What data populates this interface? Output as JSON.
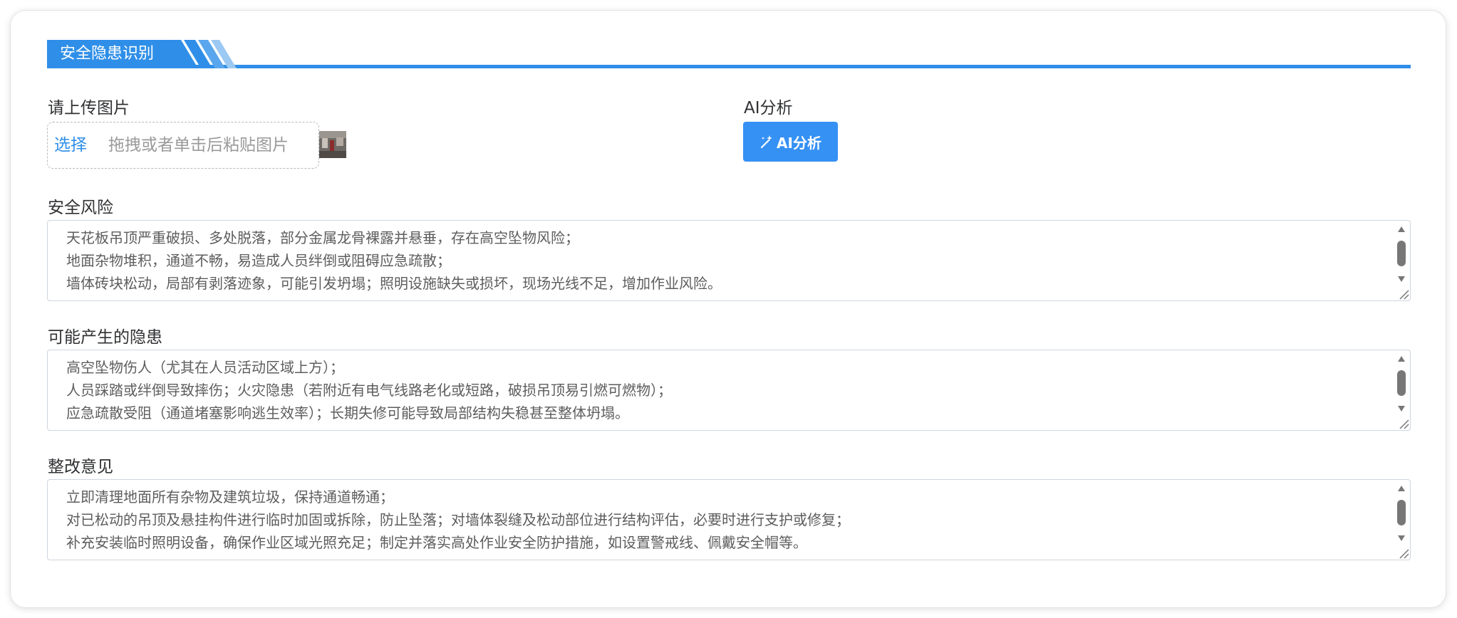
{
  "header": {
    "title": "安全隐患识别"
  },
  "upload": {
    "label": "请上传图片",
    "select_label": "选择",
    "hint": "拖拽或者单击后粘贴图片"
  },
  "ai": {
    "label": "AI分析",
    "button_label": "AI分析"
  },
  "sections": [
    {
      "title": "安全风险",
      "lines": [
        "天花板吊顶严重破损、多处脱落，部分金属龙骨裸露并悬垂，存在高空坠物风险；",
        "地面杂物堆积，通道不畅，易造成人员绊倒或阻碍应急疏散；",
        "墙体砖块松动，局部有剥落迹象，可能引发坍塌；照明设施缺失或损坏，现场光线不足，增加作业风险。"
      ]
    },
    {
      "title": "可能产生的隐患",
      "lines": [
        "高空坠物伤人（尤其在人员活动区域上方）；",
        "人员踩踏或绊倒导致摔伤；火灾隐患（若附近有电气线路老化或短路，破损吊顶易引燃可燃物）；",
        "应急疏散受阻（通道堵塞影响逃生效率）；长期失修可能导致局部结构失稳甚至整体坍塌。"
      ]
    },
    {
      "title": "整改意见",
      "lines": [
        "立即清理地面所有杂物及建筑垃圾，保持通道畅通；",
        "对已松动的吊顶及悬挂构件进行临时加固或拆除，防止坠落；对墙体裂缝及松动部位进行结构评估，必要时进行支护或修复；",
        "补充安装临时照明设备，确保作业区域光照充足；制定并落实高处作业安全防护措施，如设置警戒线、佩戴安全帽等。"
      ]
    }
  ],
  "colors": {
    "accent": "#2f8fe8",
    "button": "#3591f4"
  },
  "icons": {
    "ai_button_icon": "magic-wand-icon"
  }
}
